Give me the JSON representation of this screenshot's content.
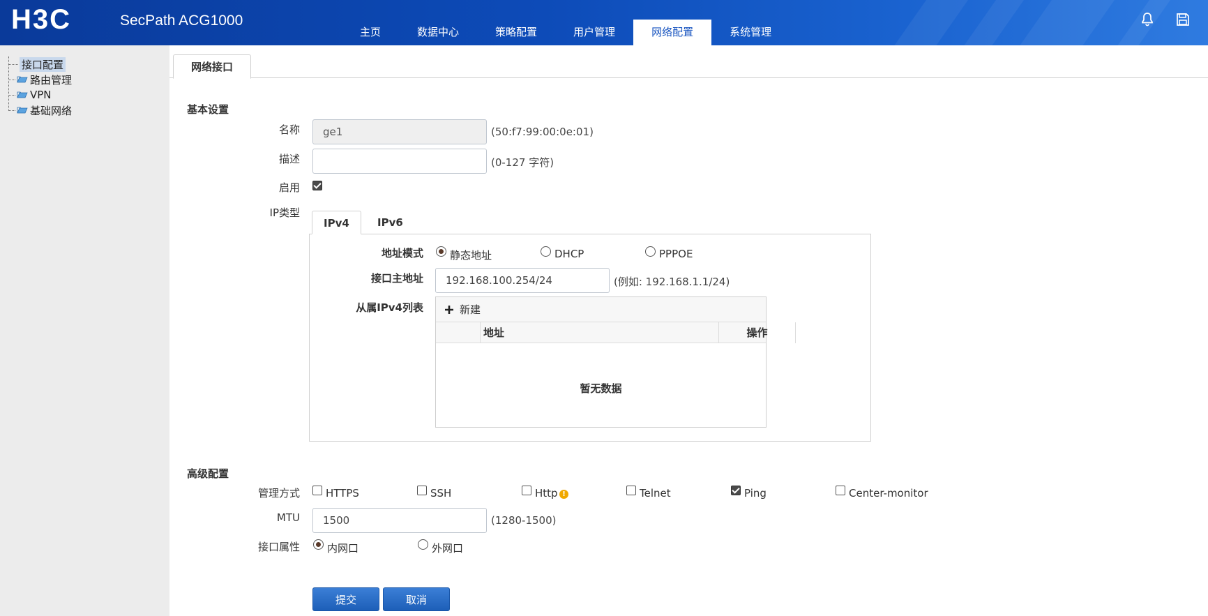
{
  "header": {
    "logo": "H3C",
    "product": "SecPath ACG1000",
    "nav": [
      "主页",
      "数据中心",
      "策略配置",
      "用户管理",
      "网络配置",
      "系统管理"
    ],
    "active_nav": "网络配置"
  },
  "sidebar": {
    "items": [
      "接口配置",
      "路由管理",
      "VPN",
      "基础网络"
    ],
    "selected": "接口配置"
  },
  "tab": {
    "label": "网络接口"
  },
  "basic": {
    "title": "基本设置",
    "name_label": "名称",
    "name_value": "ge1",
    "mac_hint": "(50:f7:99:00:0e:01)",
    "desc_label": "描述",
    "desc_value": "",
    "desc_hint": "(0-127 字符)",
    "enable_label": "启用",
    "enable_checked": true,
    "iptype_label": "IP类型",
    "ip_tabs": [
      "IPv4",
      "IPv6"
    ],
    "active_ip_tab": "IPv4",
    "addr_mode_label": "地址模式",
    "addr_modes": [
      "静态地址",
      "DHCP",
      "PPPOE"
    ],
    "addr_mode_selected": "静态地址",
    "primary_label": "接口主地址",
    "primary_value": "192.168.100.254/24",
    "primary_hint": "(例如: 192.168.1.1/24)",
    "secondary_label": "从属IPv4列表",
    "new_label": "新建",
    "col_address": "地址",
    "col_action": "操作",
    "empty_text": "暂无数据"
  },
  "advanced": {
    "title": "高级配置",
    "mgmt_label": "管理方式",
    "mgmt_options": [
      {
        "label": "HTTPS",
        "checked": false
      },
      {
        "label": "SSH",
        "checked": false
      },
      {
        "label": "Http",
        "checked": false
      },
      {
        "label": "Telnet",
        "checked": false
      },
      {
        "label": "Ping",
        "checked": true
      },
      {
        "label": "Center-monitor",
        "checked": false
      }
    ],
    "warn_glyph": "!",
    "mtu_label": "MTU",
    "mtu_value": "1500",
    "mtu_hint": "(1280-1500)",
    "attr_label": "接口属性",
    "attr_options": [
      "内网口",
      "外网口"
    ],
    "attr_selected": "内网口"
  },
  "buttons": {
    "submit": "提交",
    "cancel": "取消"
  },
  "colors": {
    "header": "#0d4bb8",
    "accent": "#1d5fb8",
    "sidebar": "#ececec"
  }
}
